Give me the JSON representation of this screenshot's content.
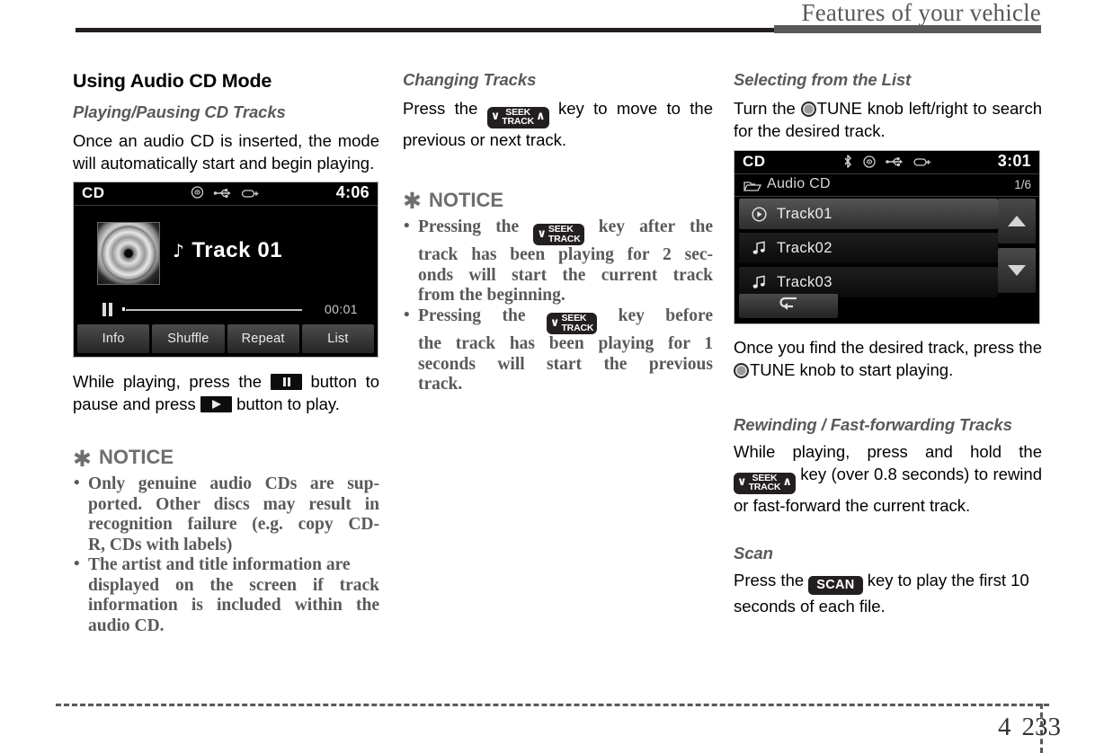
{
  "header": {
    "title": "Features of your vehicle"
  },
  "footer": {
    "chapter": "4",
    "page": "233"
  },
  "col1": {
    "section_title": "Using Audio CD Mode",
    "subsection_title": "Playing/Pausing CD Tracks",
    "intro_paragraph": "Once an audio CD is inserted, the mode will automatically start and begin playing.",
    "cd_screen": {
      "source_label": "CD",
      "clock": "4:06",
      "status_icons": [
        "disc-icon",
        "usb-icon",
        "aux-icon"
      ],
      "track_title": "Track 01",
      "elapsed_time": "00:01",
      "transport_state": "pause",
      "buttons": [
        "Info",
        "Shuffle",
        "Repeat",
        "List"
      ]
    },
    "playback_text_1": "While playing, press the",
    "playback_text_2": "button to pause and press",
    "playback_text_3": "button to play.",
    "notice_heading": "NOTICE",
    "notice_star": "✱",
    "notice_bullets": [
      "Only genuine audio CDs are supported. Other discs may result in recognition failure (e.g. copy CD-R, CDs with labels)",
      "The artist and title information are displayed on the screen if track information is included within the audio CD."
    ],
    "notice_bullet_lines": [
      [
        "Only genuine audio CDs are sup-",
        "ported. Other discs may result in",
        "recognition failure (e.g. copy CD-",
        "R, CDs with labels)"
      ],
      [
        "The artist and title information are",
        "displayed on the screen if track",
        "information is included within the",
        "audio CD."
      ]
    ]
  },
  "col2": {
    "subsection_title": "Changing Tracks",
    "text_1": "Press the",
    "text_2": "key to move to the previous or next track.",
    "notice_heading": "NOTICE",
    "notice_star": "✱",
    "bullet1_pre": "Pressing the",
    "bullet1_post_lines": [
      "key after the",
      "track has been playing for 2 sec-",
      "onds will start the current track",
      "from the beginning."
    ],
    "bullet2_pre": "Pressing the",
    "bullet2_post_lines": [
      "key before",
      "the track has been playing for 1",
      "seconds will start the previous",
      "track."
    ],
    "seek_key": {
      "label_top": "SEEK",
      "label_bottom": "TRACK",
      "chevron_left": "∨",
      "chevron_right": "∧"
    }
  },
  "col3": {
    "subsection_title": "Selecting from the List",
    "text_1": "Turn the",
    "knob_label": "TUNE",
    "text_2": "knob left/right to search for the desired track.",
    "list_screen": {
      "source_label": "CD",
      "clock": "3:01",
      "status_icons": [
        "bluetooth-icon",
        "disc-icon",
        "usb-icon",
        "aux-icon"
      ],
      "folder_name": "Audio CD",
      "page_indicator": "1/6",
      "tracks": [
        {
          "name": "Track01",
          "icon": "play-circle-icon",
          "selected": true
        },
        {
          "name": "Track02",
          "icon": "music-note-icon",
          "selected": false
        },
        {
          "name": "Track03",
          "icon": "music-note-icon",
          "selected": false
        }
      ],
      "scroll_up": "scroll-up-arrow",
      "scroll_down": "scroll-down-arrow",
      "back_button": "back-arrow-icon"
    },
    "text_3a": "Once you find the desired track, press the",
    "text_3b": "knob to start playing.",
    "subsection_title_2": "Rewinding / Fast-forwarding Tracks",
    "text_4a": "While playing, press and hold the",
    "text_4b": "key (over 0.8 seconds) to rewind or fast-forward the current track.",
    "subsection_title_3": "Scan",
    "scan_text_a": "Press the",
    "scan_key_label": "SCAN",
    "scan_text_b": "key to play the first 10 seconds of each file."
  }
}
